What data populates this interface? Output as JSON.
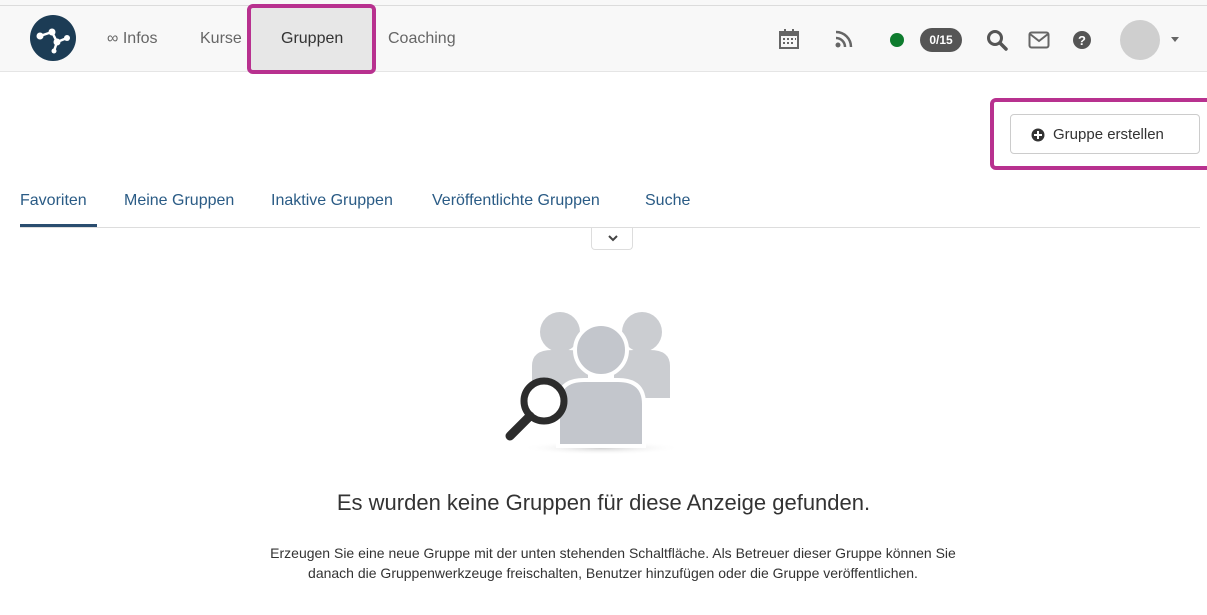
{
  "nav": {
    "items": [
      {
        "label": "∞ Infos"
      },
      {
        "label": "Kurse"
      },
      {
        "label": "Gruppen"
      },
      {
        "label": "Coaching"
      }
    ],
    "badge_count": "0/15",
    "status_color": "#0e7c2e",
    "icons": [
      "calendar-icon",
      "rss-icon",
      "search-icon",
      "mail-icon",
      "help-icon"
    ]
  },
  "actions": {
    "create_group_label": "Gruppe erstellen"
  },
  "tabs": [
    {
      "label": "Favoriten"
    },
    {
      "label": "Meine Gruppen"
    },
    {
      "label": "Inaktive Gruppen"
    },
    {
      "label": "Veröffentlichte Gruppen"
    },
    {
      "label": "Suche"
    }
  ],
  "empty_state": {
    "title": "Es wurden keine Gruppen für diese Anzeige gefunden.",
    "description": "Erzeugen Sie eine neue Gruppe mit der unten stehenden Schaltfläche. Als Betreuer dieser Gruppe können Sie danach die Gruppenwerkzeuge freischalten, Benutzer hinzufügen oder die Gruppe veröffentlichen."
  },
  "colors": {
    "highlight": "#b8318f",
    "link": "#2a5b85",
    "logo_bg": "#1c3c55"
  }
}
